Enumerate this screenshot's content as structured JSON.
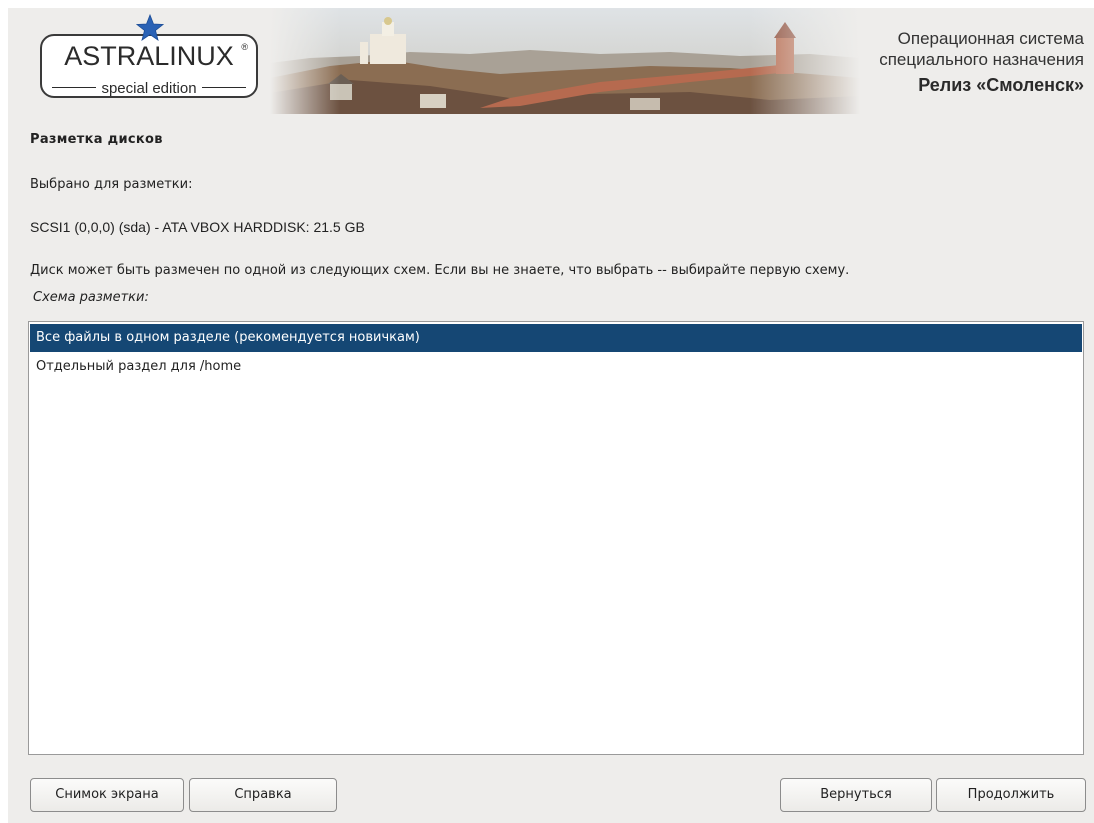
{
  "header": {
    "logo_text": "ASTRALINUX",
    "logo_registered": "®",
    "logo_subtitle": "special edition",
    "os_line1": "Операционная система",
    "os_line2": "специального назначения",
    "release": "Релиз «Смоленск»",
    "logo_star_icon": "star-icon",
    "banner_image": "smolensk-kremlin-photo"
  },
  "page": {
    "title": "Разметка дисков",
    "selected_for_label": "Выбрано для разметки:",
    "disk": "SCSI1 (0,0,0) (sda) - ATA VBOX HARDDISK: 21.5 GB",
    "description": "Диск может быть размечен по одной из следующих схем. Если вы не знаете, что выбрать -- выбирайте первую схему.",
    "scheme_label": "Схема разметки:"
  },
  "schemes": [
    {
      "label": "Все файлы в одном разделе (рекомендуется новичкам)",
      "selected": true
    },
    {
      "label": "Отдельный раздел для /home",
      "selected": false
    }
  ],
  "buttons": {
    "screenshot": "Снимок экрана",
    "help": "Справка",
    "back": "Вернуться",
    "continue": "Продолжить"
  },
  "colors": {
    "selection": "#154774",
    "background": "#eeedeb",
    "star": "#2a62b5"
  }
}
